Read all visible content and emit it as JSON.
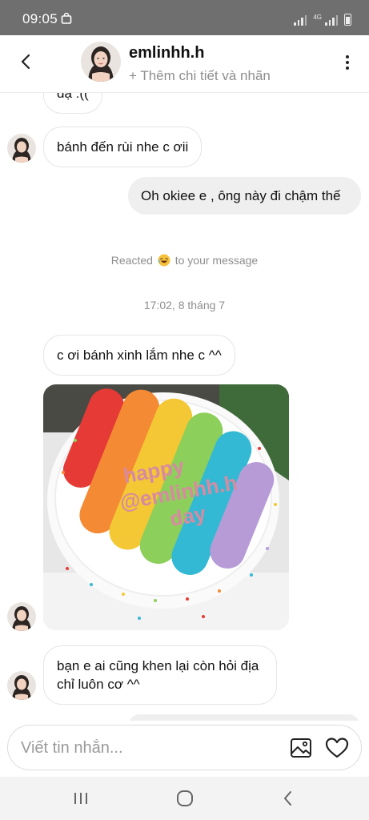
{
  "status_bar": {
    "time": "09:05",
    "network_label": "4G",
    "app_icon": "shopping-bag-icon"
  },
  "header": {
    "username": "emlinhh.h",
    "subtitle": "+ Thêm chi tiết và nhãn",
    "back_icon": "chevron-left-icon",
    "more_icon": "more-vertical-icon"
  },
  "messages": [
    {
      "type": "incoming",
      "text": "dạ :(("
    },
    {
      "type": "incoming",
      "text": "bánh đến rùi nhe c ơii"
    },
    {
      "type": "outgoing",
      "text": "Oh okiee e , ông này đi chậm thế"
    },
    {
      "type": "reaction",
      "before": "Reacted",
      "emoji": "laughing-emoji",
      "after": "to your message"
    },
    {
      "type": "timestamp",
      "text": "17:02, 8 tháng 7"
    },
    {
      "type": "incoming",
      "text": "c ơi bánh xinh lắm nhe c ^^"
    },
    {
      "type": "image",
      "cake_text": [
        "happy",
        "@emlinhh.h",
        "day"
      ]
    },
    {
      "type": "incoming",
      "text": "bạn e ai cũng khen lại còn hỏi địa chỉ luôn cơ ^^"
    }
  ],
  "composer": {
    "placeholder": "Viết tin nhắn...",
    "gallery_icon": "image-gallery-icon",
    "like_icon": "heart-icon"
  },
  "nav_bar": {
    "recents_icon": "recent-apps-icon",
    "home_icon": "home-icon",
    "back_icon": "back-icon"
  },
  "colors": {
    "status_bar": "#6f6f6f",
    "outgoing_bubble": "#efefef",
    "muted_text": "#8e8e8e"
  }
}
